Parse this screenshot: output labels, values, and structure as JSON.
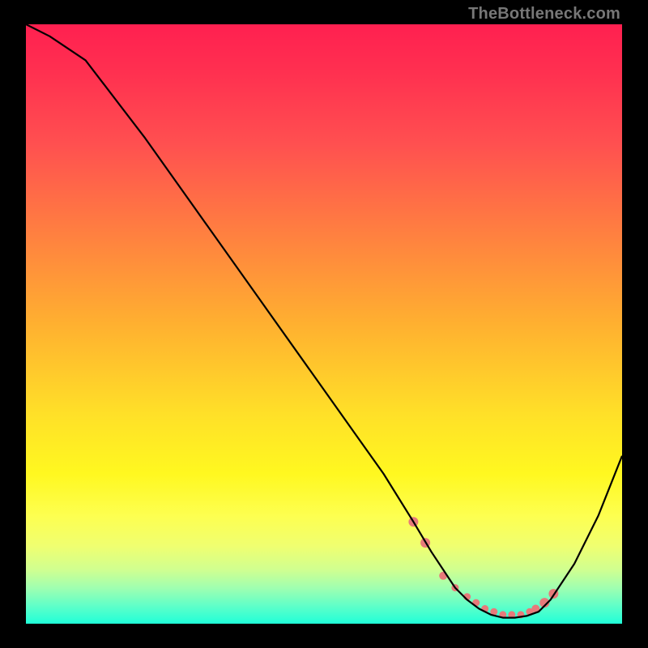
{
  "watermark": "TheBottleneck.com",
  "chart_data": {
    "type": "line",
    "title": "",
    "xlabel": "",
    "ylabel": "",
    "xlim": [
      0,
      100
    ],
    "ylim": [
      0,
      100
    ],
    "series": [
      {
        "name": "bottleneck-curve",
        "x": [
          0,
          4,
          10,
          20,
          30,
          40,
          50,
          55,
          60,
          65,
          68,
          70,
          72,
          74,
          76,
          78,
          80,
          82,
          84,
          86,
          88,
          92,
          96,
          100
        ],
        "y": [
          100,
          98,
          94,
          81,
          67,
          53,
          39,
          32,
          25,
          17,
          12,
          9,
          6,
          4,
          2.5,
          1.5,
          1,
          1,
          1.3,
          2,
          4,
          10,
          18,
          28
        ]
      }
    ],
    "markers": {
      "name": "highlight-dots",
      "x": [
        65,
        67,
        70,
        72,
        74,
        75.5,
        77,
        78.5,
        80,
        81.5,
        83,
        84.5,
        85.5,
        87,
        88.5
      ],
      "y": [
        17,
        13.5,
        8,
        6,
        4.5,
        3.5,
        2.5,
        2,
        1.5,
        1.5,
        1.5,
        2,
        2.5,
        3.5,
        5
      ],
      "r": [
        6,
        6,
        5,
        4.5,
        4.5,
        4.5,
        4.5,
        4.5,
        4.5,
        4.5,
        4.5,
        4.5,
        5,
        6,
        6
      ]
    },
    "gradient_stops": [
      {
        "pos": 0,
        "color": "#ff2050"
      },
      {
        "pos": 50,
        "color": "#ffe028"
      },
      {
        "pos": 82,
        "color": "#fdff50"
      },
      {
        "pos": 100,
        "color": "#20ffd8"
      }
    ]
  }
}
